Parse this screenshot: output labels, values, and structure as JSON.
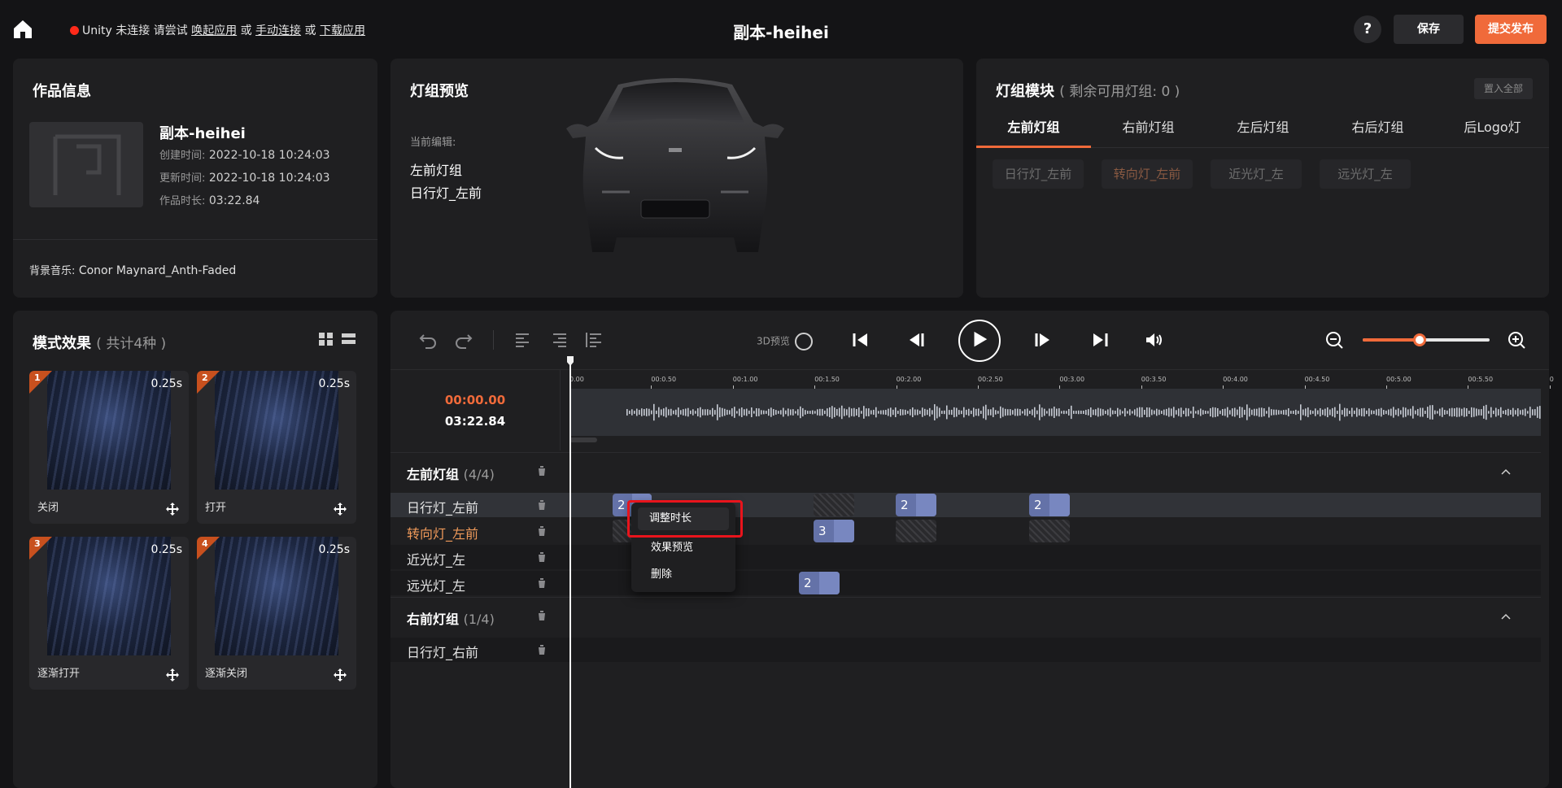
{
  "header": {
    "unity_status": "Unity 未连接 请尝试",
    "link_launch": "唤起应用",
    "or1": "或",
    "link_manual": "手动连接",
    "or2": "或",
    "link_download": "下载应用",
    "title": "副本-heihei",
    "help_label": "?",
    "save_label": "保存",
    "publish_label": "提交发布"
  },
  "work_info": {
    "title": "作品信息",
    "name": "副本-heihei",
    "created_key": "创建时间:",
    "created": "2022-10-18 10:24:03",
    "updated_key": "更新时间:",
    "updated": "2022-10-18 10:24:03",
    "duration_key": "作品时长:",
    "duration": "03:22.84",
    "music_key": "背景音乐:",
    "music": "Conor Maynard_Anth-Faded"
  },
  "preview": {
    "title": "灯组预览",
    "editing_label": "当前编辑:",
    "group": "左前灯组",
    "light": "日行灯_左前"
  },
  "module": {
    "title": "灯组模块",
    "remaining": "( 剩余可用灯组: 0 )",
    "put_all": "置入全部",
    "tabs": [
      "左前灯组",
      "右前灯组",
      "左后灯组",
      "右后灯组",
      "后Logo灯"
    ],
    "active_tab": 0,
    "chips": [
      "日行灯_左前",
      "转向灯_左前",
      "近光灯_左",
      "远光灯_左"
    ],
    "active_chip": 1
  },
  "effects": {
    "title": "模式效果",
    "count": "( 共计4种 )",
    "items": [
      {
        "index": "1",
        "duration": "0.25s",
        "name": "关闭"
      },
      {
        "index": "2",
        "duration": "0.25s",
        "name": "打开"
      },
      {
        "index": "3",
        "duration": "0.25s",
        "name": "逐渐打开"
      },
      {
        "index": "4",
        "duration": "0.25s",
        "name": "逐渐关闭"
      }
    ]
  },
  "timeline": {
    "preview_3d": "3D预览",
    "current_time": "00:00.00",
    "total_time": "03:22.84",
    "zoom_level": 0.45,
    "playhead_time": "00:00.00",
    "ruler_ticks": [
      "0.00",
      "00:0.50",
      "00:1.00",
      "00:1.50",
      "00:2.00",
      "00:2.50",
      "00:3.00",
      "00:3.50",
      "00:4.00",
      "00:4.50",
      "00:5.00",
      "00:5.50",
      "0"
    ],
    "groups": [
      {
        "name": "左前灯组",
        "count": "(4/4)",
        "rows": [
          {
            "label": "日行灯_左前",
            "blocks": [
              "2",
              "2",
              "2"
            ]
          },
          {
            "label": "转向灯_左前",
            "blocks": [
              "3"
            ]
          },
          {
            "label": "近光灯_左",
            "blocks": []
          },
          {
            "label": "远光灯_左",
            "blocks": [
              "2"
            ]
          }
        ]
      },
      {
        "name": "右前灯组",
        "count": "(1/4)",
        "rows": [
          {
            "label": "日行灯_右前",
            "blocks": []
          }
        ]
      }
    ]
  },
  "context_menu": {
    "items": [
      "调整时长",
      "效果预览",
      "删除"
    ]
  },
  "colors": {
    "accent": "#f06a3a",
    "block": "#6472a8",
    "highlight": "#e8141c",
    "panel": "#1f1f21"
  }
}
